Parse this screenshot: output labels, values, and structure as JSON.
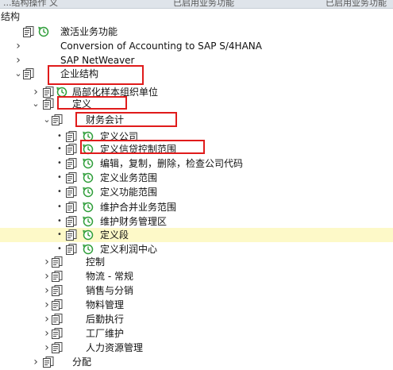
{
  "header": {
    "fragment_left": "...结构操作   义",
    "fragment_mid": "已启用业务功能",
    "fragment_right": "已启用业务功能"
  },
  "panel_title": "结构",
  "tree": [
    {
      "label": "激活业务功能",
      "expander": "none",
      "icons": [
        "doc-icon",
        "clock-icon"
      ]
    },
    {
      "label": "Conversion of Accounting to SAP S/4HANA",
      "expander": "collapsed",
      "icons": []
    },
    {
      "label": "SAP NetWeaver",
      "expander": "collapsed",
      "icons": []
    },
    {
      "label": "企业结构",
      "expander": "expanded",
      "icons": [
        "doc-icon"
      ]
    },
    {
      "label": "局部化样本组织单位",
      "expander": "collapsed",
      "icons": [
        "doc-icon",
        "clock-icon"
      ]
    },
    {
      "label": "定义",
      "expander": "expanded",
      "icons": [
        "doc-icon"
      ]
    },
    {
      "label": "财务会计",
      "expander": "expanded",
      "icons": [
        "doc-icon"
      ]
    },
    {
      "label": "定义公司",
      "expander": "bullet",
      "icons": [
        "doc-icon",
        "clock-icon"
      ]
    },
    {
      "label": "定义信贷控制范围",
      "expander": "bullet",
      "icons": [
        "doc-icon",
        "clock-icon"
      ]
    },
    {
      "label": "编辑，复制，删除，检查公司代码",
      "expander": "bullet",
      "icons": [
        "doc-icon",
        "clock-icon"
      ]
    },
    {
      "label": "定义业务范围",
      "expander": "bullet",
      "icons": [
        "doc-icon",
        "clock-icon"
      ]
    },
    {
      "label": "定义功能范围",
      "expander": "bullet",
      "icons": [
        "doc-icon",
        "clock-icon"
      ]
    },
    {
      "label": "维护合并业务范围",
      "expander": "bullet",
      "icons": [
        "doc-icon",
        "clock-icon"
      ]
    },
    {
      "label": "维护财务管理区",
      "expander": "bullet",
      "icons": [
        "doc-icon",
        "clock-icon"
      ]
    },
    {
      "label": "定义段",
      "expander": "bullet",
      "icons": [
        "doc-icon",
        "clock-icon"
      ],
      "highlighted": true
    },
    {
      "label": "定义利润中心",
      "expander": "bullet",
      "icons": [
        "doc-icon",
        "clock-icon"
      ]
    },
    {
      "label": "控制",
      "expander": "collapsed",
      "icons": [
        "doc-icon"
      ]
    },
    {
      "label": "物流 - 常规",
      "expander": "collapsed",
      "icons": [
        "doc-icon"
      ]
    },
    {
      "label": "销售与分销",
      "expander": "collapsed",
      "icons": [
        "doc-icon"
      ]
    },
    {
      "label": "物料管理",
      "expander": "collapsed",
      "icons": [
        "doc-icon"
      ]
    },
    {
      "label": "后勤执行",
      "expander": "collapsed",
      "icons": [
        "doc-icon"
      ]
    },
    {
      "label": "工厂维护",
      "expander": "collapsed",
      "icons": [
        "doc-icon"
      ]
    },
    {
      "label": "人力资源管理",
      "expander": "collapsed",
      "icons": [
        "doc-icon"
      ]
    },
    {
      "label": "分配",
      "expander": "collapsed",
      "icons": [
        "doc-icon"
      ]
    }
  ],
  "colors": {
    "annotation_box": "#e01b1b",
    "highlight_row": "#fdf9c8",
    "clock_green": "#2f9e3a"
  }
}
